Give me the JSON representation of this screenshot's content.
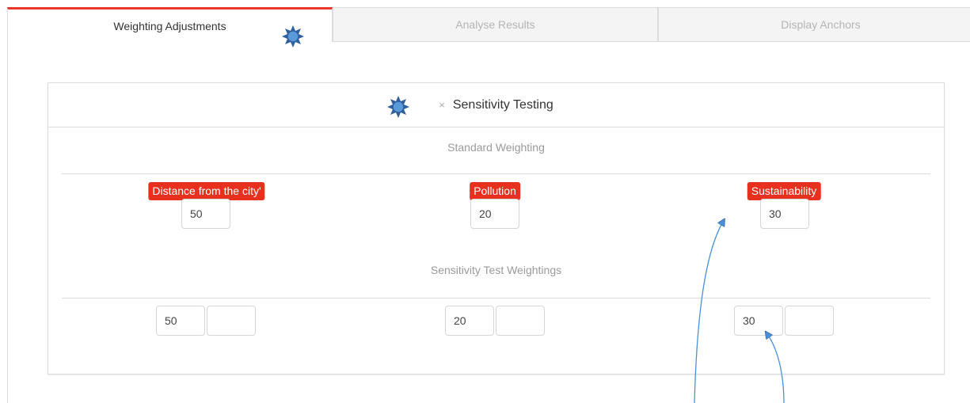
{
  "tabs": {
    "weighting": "Weighting Adjustments",
    "analyse": "Analyse Results",
    "anchors": "Display Anchors"
  },
  "panel": {
    "title": "Sensitivity Testing",
    "close_glyph": "×",
    "standard_heading": "Standard Weighting",
    "sensitivity_heading": "Sensitivity Test Weightings"
  },
  "criteria": [
    {
      "label": "Distance from the city'",
      "standard": "50",
      "test_value": "50",
      "test_extra": ""
    },
    {
      "label": "Pollution",
      "standard": "20",
      "test_value": "20",
      "test_extra": ""
    },
    {
      "label": "Sustainability",
      "standard": "30",
      "test_value": "30",
      "test_extra": ""
    }
  ],
  "colors": {
    "accent": "#e8382b",
    "badge": "#e8301e",
    "annotation": "#4a90d9"
  },
  "icons": {
    "tab_marker": "star-burst-icon",
    "panel_marker": "star-burst-icon",
    "close": "close-icon"
  }
}
